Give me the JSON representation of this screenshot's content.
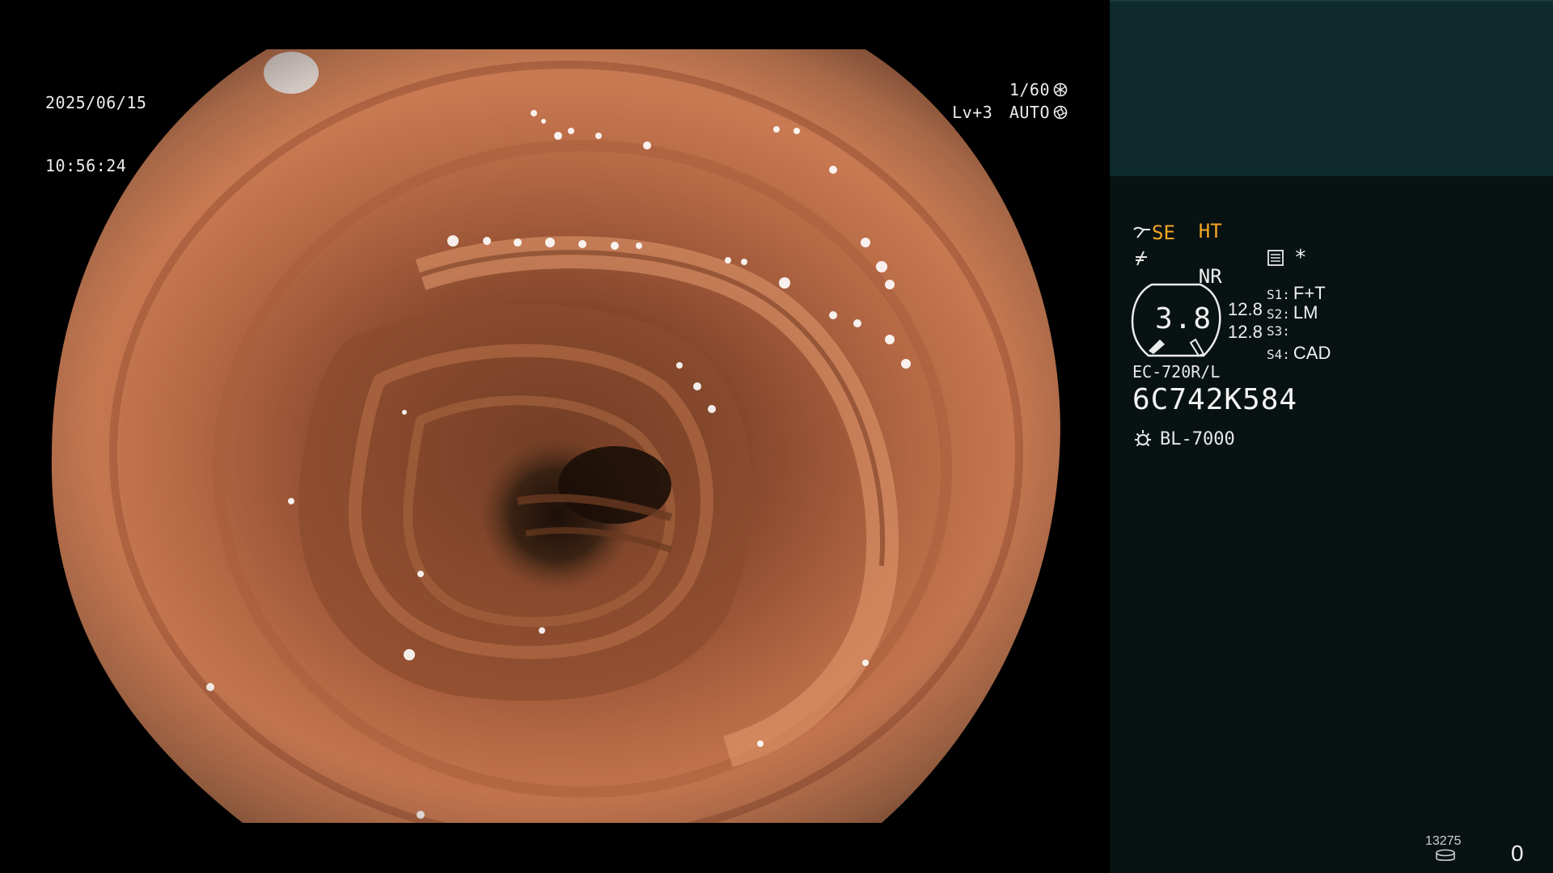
{
  "osd": {
    "date": "2025/06/15",
    "time": "10:56:24",
    "shutter": "1/60",
    "level": "Lv+3",
    "iris_mode": "AUTO"
  },
  "panel": {
    "mode_ht": "HT",
    "mode_nr": "NR",
    "mode_se": "SE",
    "dial_value": "3.8",
    "dial_side_top": "12.8",
    "dial_side_bottom": "12.8",
    "s1_label": "S1:",
    "s1_value": "F+T",
    "s2_label": "S2:",
    "s2_value": "LM",
    "s3_label": "S3:",
    "s3_value": "",
    "s4_label": "S4:",
    "s4_value": "CAD",
    "asterisk": "*",
    "scope_model": "EC-720R/L",
    "serial_number": "6C742K584",
    "light_source": "BL-7000",
    "frame_count": "13275",
    "counter": "0"
  },
  "icons": {
    "shutter": "shutter-icon",
    "iris": "iris-icon",
    "scope": "scope-tip-icon",
    "filter": "filter-slash-icon",
    "preset": "preset-list-icon",
    "light": "light-source-icon",
    "storage": "storage-disk-icon"
  },
  "colors": {
    "panel_bg": "#081212",
    "panel_top": "#0e2a2a",
    "accent_orange": "#f5a623",
    "tissue": "#c8704e"
  }
}
